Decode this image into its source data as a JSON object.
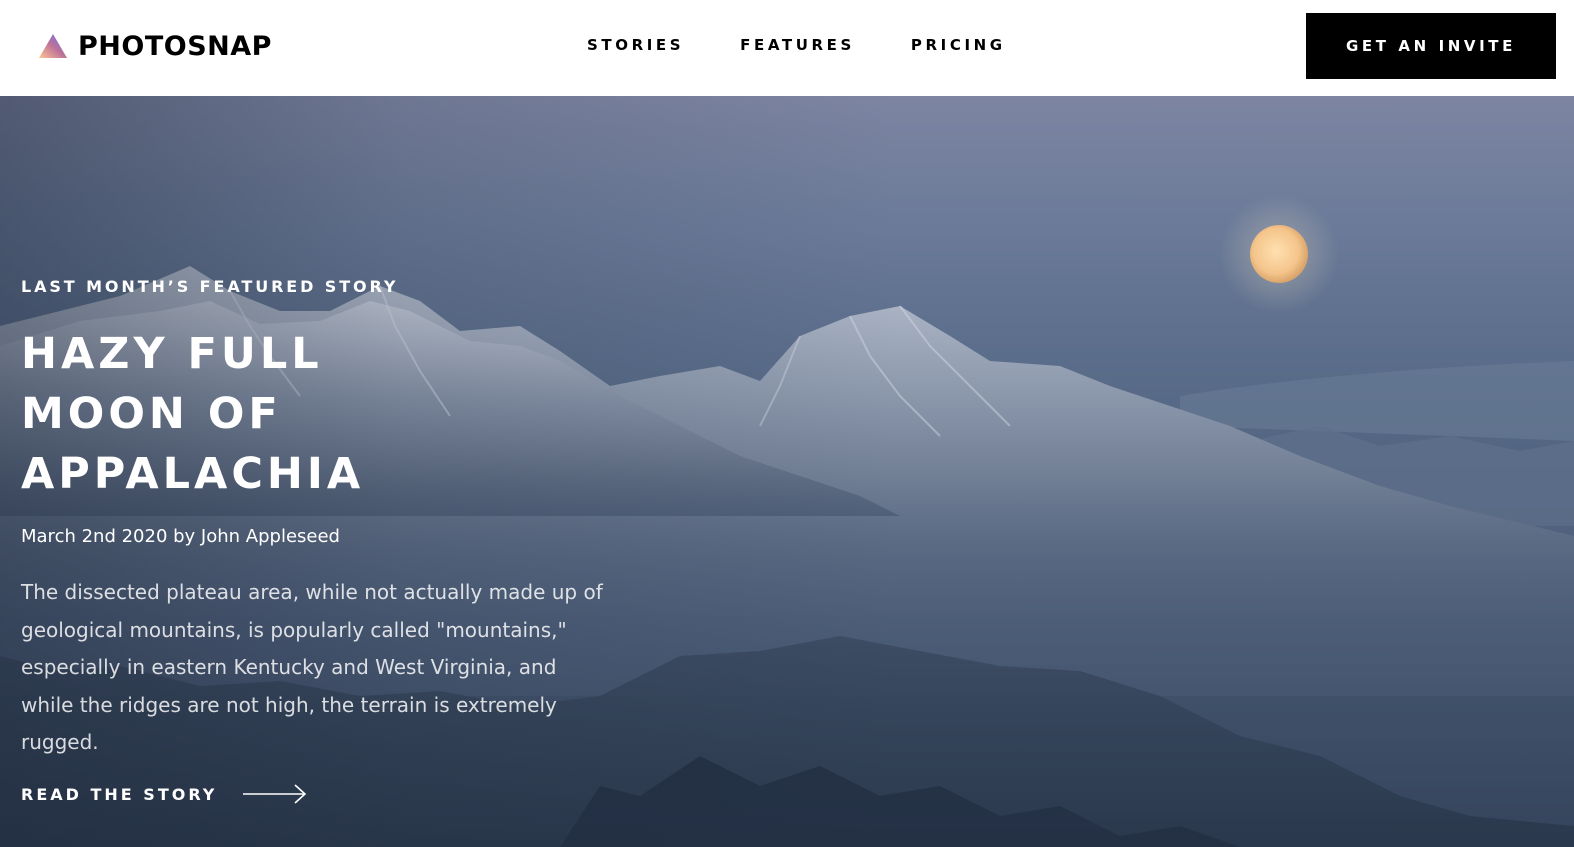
{
  "header": {
    "logo_text": "PHOTOSNAP",
    "nav": [
      {
        "label": "STORIES"
      },
      {
        "label": "FEATURES"
      },
      {
        "label": "PRICING"
      }
    ],
    "cta_label": "GET AN INVITE"
  },
  "hero": {
    "kicker": "LAST MONTH’S FEATURED STORY",
    "title": "HAZY FULL MOON OF APPALACHIA",
    "byline": "March 2nd 2020 by John Appleseed",
    "summary": "The dissected plateau area, while not actually made up of geological mountains, is popularly called \"mountains,\" especially in eastern Kentucky and West Virginia, and while the ridges are not high, the terrain is extremely rugged.",
    "link_label": "READ THE STORY",
    "link_icon": "arrow-right-icon"
  },
  "colors": {
    "logo_gradient": [
      "#FFC593",
      "#BC7198",
      "#5A77FF"
    ],
    "cta_bg": "#000000",
    "text_light": "#FFFFFF"
  }
}
